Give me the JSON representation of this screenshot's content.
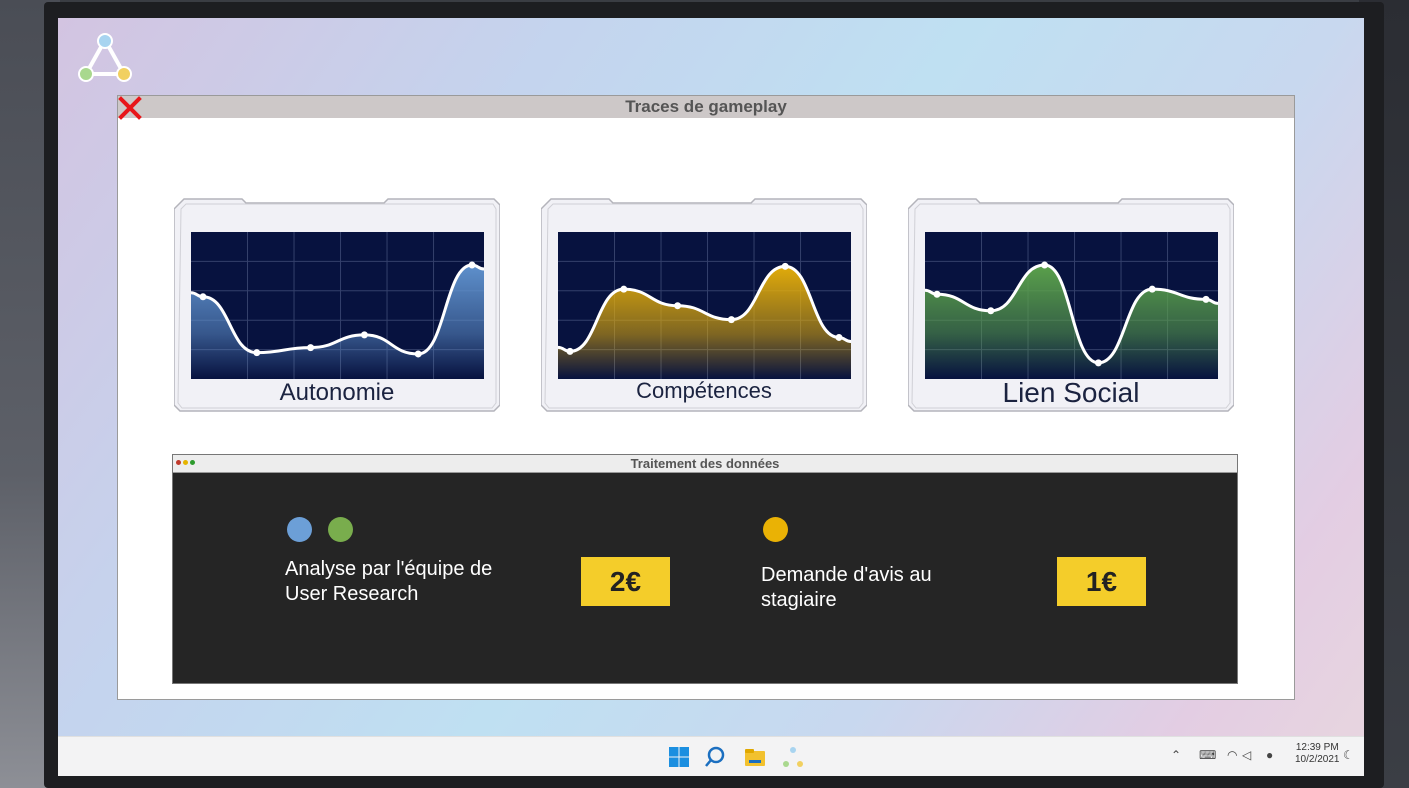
{
  "window": {
    "title": "Traces de gameplay"
  },
  "cards": [
    {
      "label": "Autonomie",
      "color": "#5e90cc"
    },
    {
      "label": "Compétences",
      "color": "#e1ab0a"
    },
    {
      "label": "Lien Social",
      "color": "#5aa04b"
    }
  ],
  "chart_data": [
    {
      "type": "area",
      "title": "Autonomie",
      "values": [
        0.6,
        0.16,
        0.2,
        0.3,
        0.15,
        0.85
      ],
      "ylim": [
        0,
        1
      ],
      "grid": true,
      "color": "#5e90cc"
    },
    {
      "type": "area",
      "title": "Compétences",
      "values": [
        0.17,
        0.66,
        0.53,
        0.42,
        0.84,
        0.28
      ],
      "ylim": [
        0,
        1
      ],
      "grid": true,
      "color": "#e1ab0a"
    },
    {
      "type": "area",
      "title": "Lien Social",
      "values": [
        0.62,
        0.49,
        0.85,
        0.08,
        0.66,
        0.58
      ],
      "ylim": [
        0,
        1
      ],
      "grid": true,
      "color": "#5aa04b"
    }
  ],
  "panel": {
    "title": "Traitement des données",
    "options": [
      {
        "text_line1": "Analyse par l'équipe de",
        "text_line2": "User Research",
        "price": "2€",
        "dot_colors": [
          "#6c9fd7",
          "#79ad4d"
        ]
      },
      {
        "text_line1": "Demande d'avis au",
        "text_line2": "stagiaire",
        "price": "1€",
        "dot_colors": [
          "#eab205"
        ]
      }
    ]
  },
  "taskbar": {
    "icons": [
      "windows-start-icon",
      "search-icon",
      "file-explorer-icon",
      "app-network-icon"
    ],
    "tray_icons": [
      "chevron-up-icon",
      "keyboard-icon",
      "wifi-icon",
      "volume-icon",
      "webcam-icon",
      "moon-icon"
    ],
    "time": "12:39 PM",
    "date": "10/2/2021"
  }
}
